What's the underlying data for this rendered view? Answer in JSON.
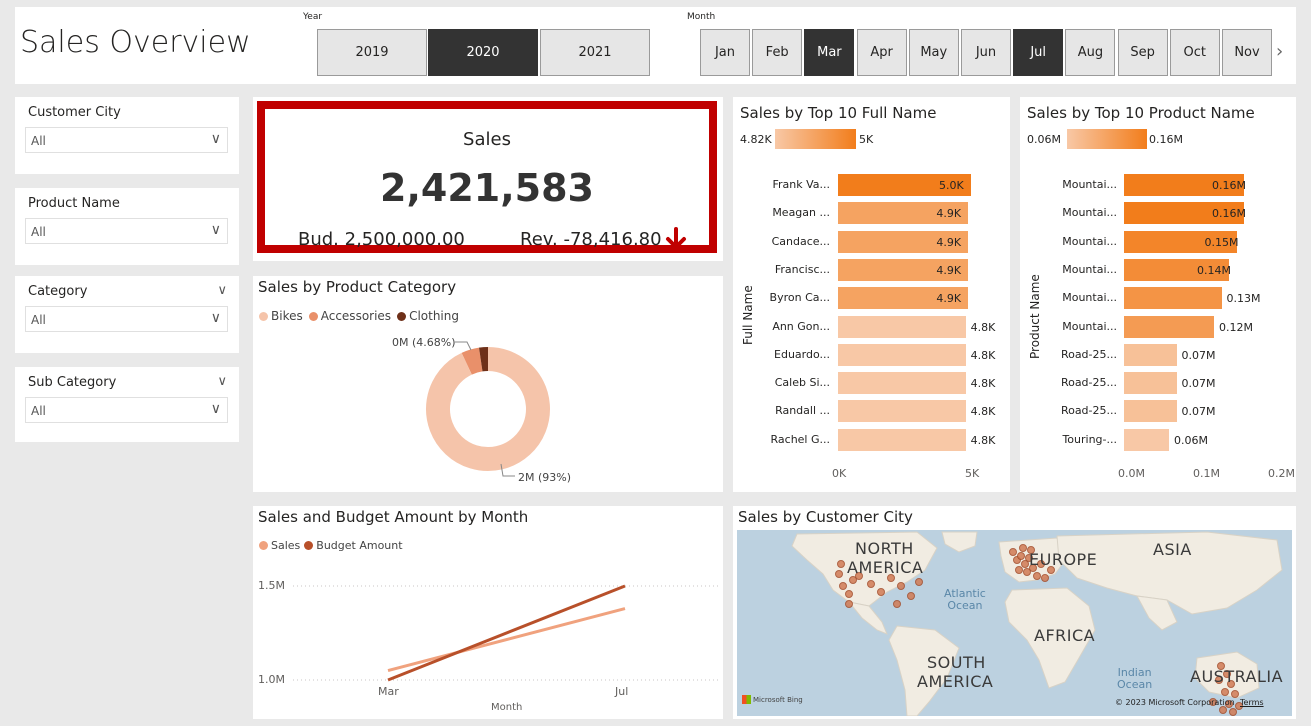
{
  "header": {
    "title": "Sales Overview",
    "year_label": "Year",
    "month_label": "Month",
    "years": [
      {
        "label": "2019",
        "selected": false
      },
      {
        "label": "2020",
        "selected": true
      },
      {
        "label": "2021",
        "selected": false
      }
    ],
    "months": [
      {
        "label": "Jan",
        "selected": false
      },
      {
        "label": "Feb",
        "selected": false
      },
      {
        "label": "Mar",
        "selected": true
      },
      {
        "label": "Apr",
        "selected": false
      },
      {
        "label": "May",
        "selected": false
      },
      {
        "label": "Jun",
        "selected": false
      },
      {
        "label": "Jul",
        "selected": true
      },
      {
        "label": "Aug",
        "selected": false
      },
      {
        "label": "Sep",
        "selected": false
      },
      {
        "label": "Oct",
        "selected": false
      },
      {
        "label": "Nov",
        "selected": false
      }
    ],
    "next_icon": "chevron-right-icon"
  },
  "filters": [
    {
      "label": "Customer City",
      "value": "All"
    },
    {
      "label": "Product Name",
      "value": "All"
    },
    {
      "label": "Category",
      "value": "All"
    },
    {
      "label": "Sub Category",
      "value": "All"
    }
  ],
  "kpi": {
    "label": "Sales",
    "value": "2,421,583",
    "budget": "Bud. 2,500,000.00",
    "revision": "Rev. -78,416.80",
    "trend_icon": "arrow-down-icon",
    "border_color": "#c00000",
    "trend_color": "#c00000"
  },
  "donut": {
    "title": "Sales by Product Category",
    "legend": [
      {
        "name": "Bikes",
        "color": "#f5c4aa"
      },
      {
        "name": "Accessories",
        "color": "#e9906a"
      },
      {
        "name": "Clothing",
        "color": "#6e3019"
      }
    ],
    "label_small": "0M (4.68%)",
    "label_large": "2M (93%)"
  },
  "fullname_chart": {
    "title": "Sales by Top 10 Full Name",
    "y_title": "Full Name",
    "legend_min": "4.82K",
    "legend_max": "5K",
    "x_ticks": [
      "0K",
      "5K"
    ]
  },
  "product_chart": {
    "title": "Sales by Top 10 Product Name",
    "y_title": "Product Name",
    "legend_min": "0.06M",
    "legend_max": "0.16M",
    "x_ticks": [
      "0.0M",
      "0.1M",
      "0.2M"
    ]
  },
  "line_chart": {
    "title": "Sales and Budget Amount by Month",
    "legend": [
      {
        "name": "Sales",
        "color": "#f0a27e"
      },
      {
        "name": "Budget Amount",
        "color": "#b8502a"
      }
    ],
    "y_ticks": [
      "1.5M",
      "1.0M"
    ],
    "x_ticks": [
      "Mar",
      "Jul"
    ],
    "x_title": "Month"
  },
  "map": {
    "title": "Sales by Customer City",
    "labels": [
      "NORTH",
      "AMERICA",
      "EUROPE",
      "ASIA",
      "AFRICA",
      "SOUTH",
      "AMERICA",
      "AUSTRALIA"
    ],
    "oceans": [
      "Atlantic",
      "Ocean",
      "Indian",
      "Ocean"
    ],
    "attribution": "© 2023 Microsoft Corporation",
    "terms": "Terms",
    "brand": "Microsoft Bing"
  },
  "chart_data": [
    {
      "type": "bar",
      "title": "Sales by Top 10 Full Name",
      "ylabel": "Full Name",
      "categories": [
        "Frank Va...",
        "Meagan ...",
        "Candace...",
        "Francisc...",
        "Byron Ca...",
        "Ann Gon...",
        "Eduardo...",
        "Caleb Si...",
        "Randall ...",
        "Rachel G..."
      ],
      "values": [
        5000,
        4900,
        4900,
        4900,
        4900,
        4800,
        4800,
        4800,
        4800,
        4800
      ],
      "data_labels": [
        "5.0K",
        "4.9K",
        "4.9K",
        "4.9K",
        "4.9K",
        "4.8K",
        "4.8K",
        "4.8K",
        "4.8K",
        "4.8K"
      ],
      "xlim": [
        0,
        5000
      ],
      "color_scale": [
        "#f8c8a6",
        "#f27d1b"
      ]
    },
    {
      "type": "bar",
      "title": "Sales by Top 10 Product Name",
      "ylabel": "Product Name",
      "categories": [
        "Mountai...",
        "Mountai...",
        "Mountai...",
        "Mountai...",
        "Mountai...",
        "Mountai...",
        "Road-25...",
        "Road-25...",
        "Road-25...",
        "Touring-..."
      ],
      "values": [
        160000,
        160000,
        150000,
        140000,
        130000,
        120000,
        70000,
        70000,
        70000,
        60000
      ],
      "data_labels": [
        "0.16M",
        "0.16M",
        "0.15M",
        "0.14M",
        "0.13M",
        "0.12M",
        "0.07M",
        "0.07M",
        "0.07M",
        "0.06M"
      ],
      "xlim": [
        0,
        200000
      ],
      "color_scale": [
        "#f8c8a6",
        "#f27d1b"
      ]
    },
    {
      "type": "pie",
      "title": "Sales by Product Category",
      "categories": [
        "Bikes",
        "Accessories",
        "Clothing"
      ],
      "values": [
        93,
        4.68,
        2.32
      ]
    },
    {
      "type": "line",
      "title": "Sales and Budget Amount by Month",
      "xlabel": "Month",
      "x": [
        "Mar",
        "Jul"
      ],
      "series": [
        {
          "name": "Sales",
          "values": [
            1050000,
            1380000
          ]
        },
        {
          "name": "Budget Amount",
          "values": [
            1000000,
            1500000
          ]
        }
      ],
      "ylim": [
        1000000,
        1500000
      ]
    }
  ]
}
